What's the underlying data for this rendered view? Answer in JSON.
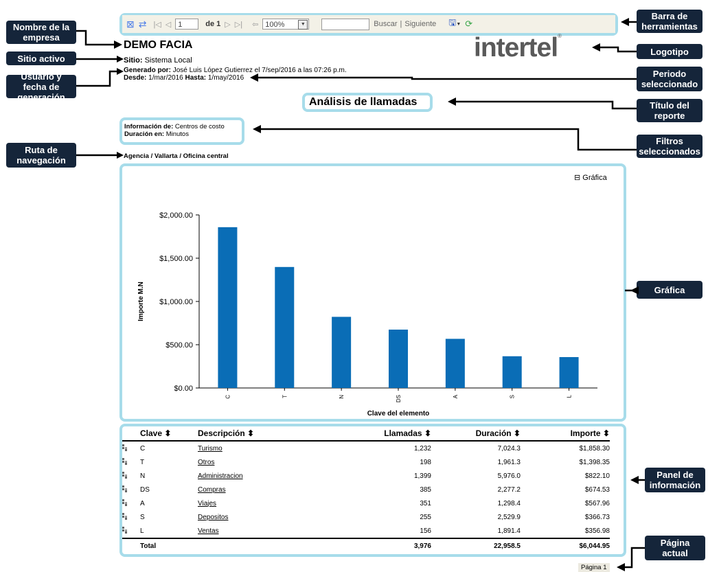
{
  "toolbar": {
    "page_current": "1",
    "page_of": "de 1",
    "zoom": "100%",
    "search_label": "Buscar",
    "separator": "|",
    "next_label": "Siguiente"
  },
  "report": {
    "company": "DEMO FACIA",
    "logo": "intertel",
    "logo_tm": "®",
    "site_label": "Sitio:",
    "site_value": "Sistema Local",
    "generated_label": "Generado por:",
    "generated_value": "José Luis López Gutierrez el 7/sep/2016 a las 07:26 p.m.",
    "from_label": "Desde:",
    "from_value": "1/mar/2016",
    "to_label": "Hasta:",
    "to_value": "1/may/2016",
    "title": "Análisis de llamadas",
    "filter_info_label": "Información de:",
    "filter_info_value": "Centros de costo",
    "filter_duration_label": "Duración en:",
    "filter_duration_value": "Minutos",
    "route": "Agencia / Vallarta / Oficina central",
    "chart_toggle": "⊟ Gráfica",
    "page_indicator": "Página  1"
  },
  "callouts": {
    "company_name": "Nombre de la empresa",
    "active_site": "Sitio activo",
    "user_date": "Usuario y fecha de generación",
    "route": "Ruta de navegación",
    "toolbar": "Barra de herramientas",
    "logo": "Logotipo",
    "period": "Periodo seleccionado",
    "report_title": "Título del reporte",
    "filters": "Filtros seleccionados",
    "chart": "Gráfica",
    "info_panel": "Panel de información",
    "current_page": "Página actual"
  },
  "colors": {
    "bar": "#0a6db6",
    "frame": "#a7dcea",
    "callout": "#15253a"
  },
  "chart_data": {
    "type": "bar",
    "categories": [
      "C",
      "T",
      "N",
      "DS",
      "A",
      "S",
      "L"
    ],
    "values": [
      1858.3,
      1398.35,
      822.1,
      674.53,
      567.96,
      366.73,
      356.98
    ],
    "xlabel": "Clave del elemento",
    "ylabel": "Importe M.N",
    "ylim": [
      0,
      2000
    ],
    "yticks": [
      "$0.00",
      "$500.00",
      "$1,000.00",
      "$1,500.00",
      "$2,000.00"
    ],
    "grid": false
  },
  "table": {
    "headers": [
      "Clave ⬍",
      "Descripción ⬍",
      "Llamadas ⬍",
      "Duración  ⬍",
      "Importe ⬍"
    ],
    "rows": [
      {
        "clave": "C",
        "desc": "Turismo",
        "llamadas": "1,232",
        "duracion": "7,024.3",
        "importe": "$1,858.30"
      },
      {
        "clave": "T",
        "desc": "Otros",
        "llamadas": "198",
        "duracion": "1,961.3",
        "importe": "$1,398.35"
      },
      {
        "clave": "N",
        "desc": "Administracion",
        "llamadas": "1,399",
        "duracion": "5,976.0",
        "importe": "$822.10"
      },
      {
        "clave": "DS",
        "desc": "Compras",
        "llamadas": "385",
        "duracion": "2,277.2",
        "importe": "$674.53"
      },
      {
        "clave": "A",
        "desc": "Viajes",
        "llamadas": "351",
        "duracion": "1,298.4",
        "importe": "$567.96"
      },
      {
        "clave": "S",
        "desc": "Depositos",
        "llamadas": "255",
        "duracion": "2,529.9",
        "importe": "$366.73"
      },
      {
        "clave": "L",
        "desc": "Ventas",
        "llamadas": "156",
        "duracion": "1,891.4",
        "importe": "$356.98"
      }
    ],
    "total": {
      "label": "Total",
      "llamadas": "3,976",
      "duracion": "22,958.5",
      "importe": "$6,044.95"
    }
  }
}
